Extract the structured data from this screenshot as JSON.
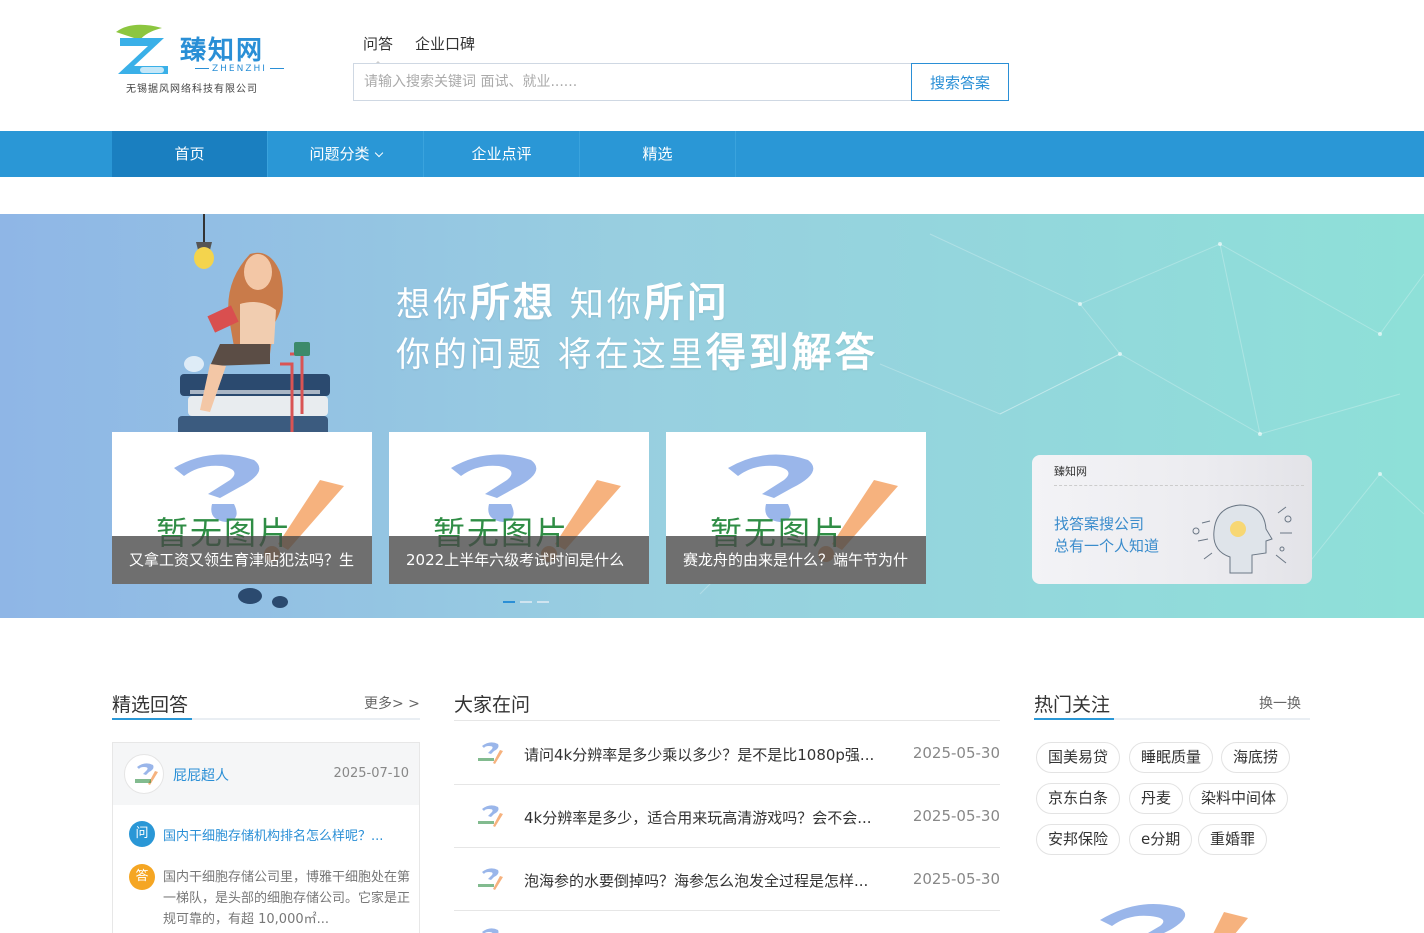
{
  "header": {
    "logo_name": "臻知网",
    "logo_en": "ZHENZHI",
    "logo_company": "无锡据风网络科技有限公司",
    "search_tabs": [
      "问答",
      "企业口碑"
    ],
    "search_placeholder": "请输入搜索关键词 面试、就业......",
    "search_button": "搜索答案"
  },
  "nav": {
    "items": [
      "首页",
      "问题分类",
      "企业点评",
      "精选"
    ]
  },
  "banner": {
    "slogan1_a": "想你",
    "slogan1_b": "所想",
    "slogan1_c": "知你",
    "slogan1_d": "所问",
    "slogan2_a": "你的问题 将在这里",
    "slogan2_b": "得到解答",
    "placeholder_text": "暂无图片",
    "cards": [
      "又拿工资又领生育津贴犯法吗？生",
      "2022上半年六级考试时间是什么",
      "赛龙舟的由来是什么？端午节为什"
    ],
    "promo": {
      "brand": "臻知网",
      "line1": "找答案搜公司",
      "line2": "总有一个人知道"
    }
  },
  "featured": {
    "title": "精选回答",
    "more": "更多> >",
    "user": "屁屁超人",
    "date": "2025-07-10",
    "q_badge": "问",
    "a_badge": "答",
    "question": "国内干细胞存储机构排名怎么样呢？...",
    "answer": "国内干细胞存储公司里，博雅干细胞处在第一梯队，是头部的细胞存储公司。它家是正规可靠的，有超 10,000㎡..."
  },
  "asking": {
    "title": "大家在问",
    "rows": [
      {
        "q": "请问4k分辨率是多少乘以多少？是不是比1080p强...",
        "d": "2025-05-30"
      },
      {
        "q": "4k分辨率是多少，适合用来玩高清游戏吗？会不会...",
        "d": "2025-05-30"
      },
      {
        "q": "泡海参的水要倒掉吗？海参怎么泡发全过程是怎样...",
        "d": "2025-05-30"
      }
    ]
  },
  "hot": {
    "title": "热门关注",
    "refresh": "换一换",
    "tags": [
      "国美易贷",
      "睡眠质量",
      "海底捞",
      "京东白条",
      "丹麦",
      "染料中间体",
      "安邦保险",
      "e分期",
      "重婚罪"
    ]
  }
}
